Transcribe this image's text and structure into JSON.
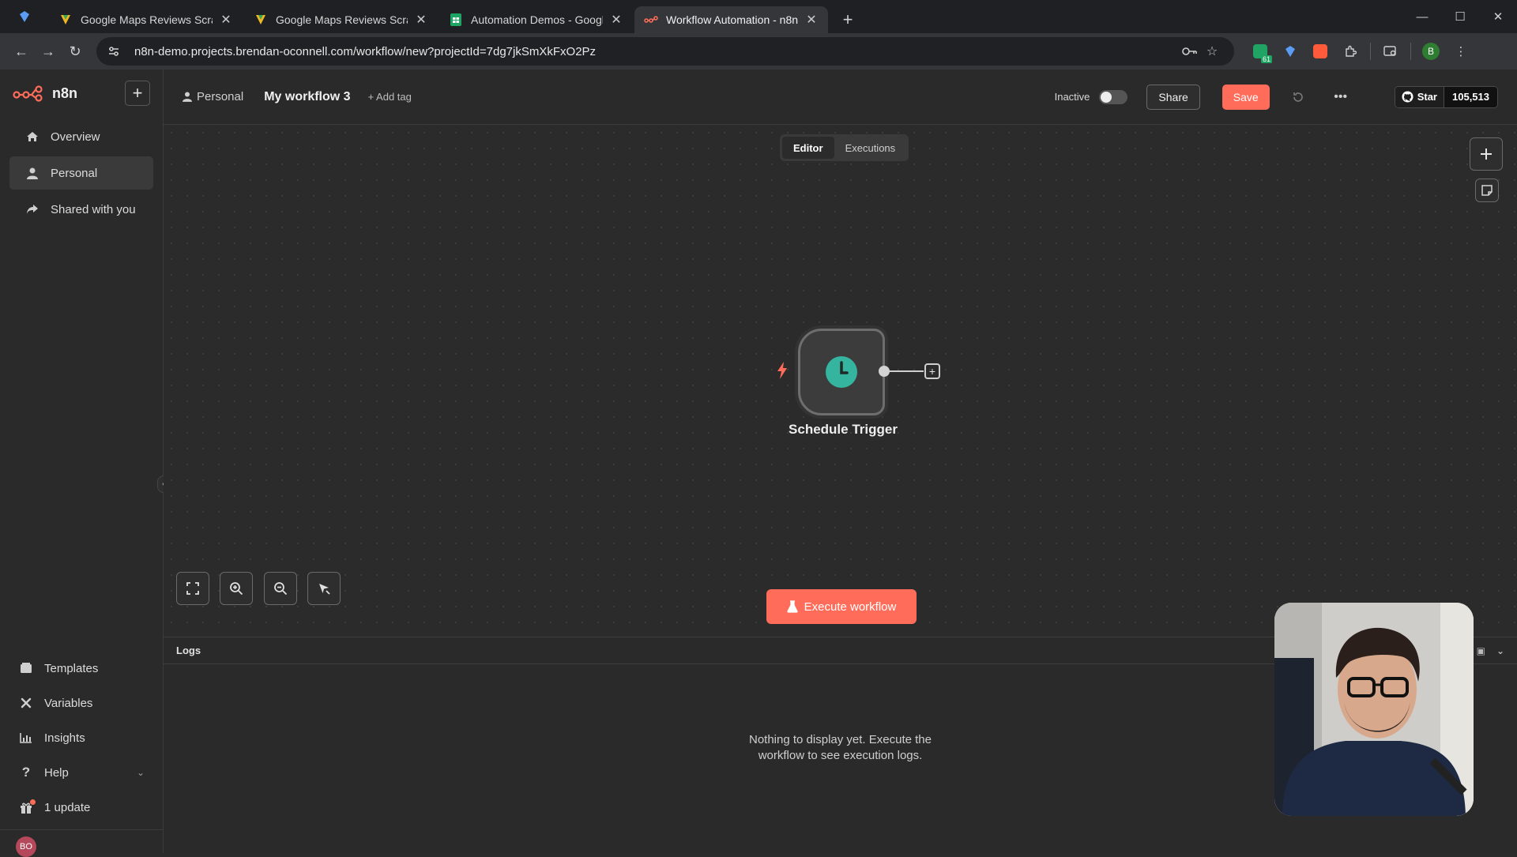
{
  "browser": {
    "tabs": [
      {
        "title": "Google Maps Reviews Scraper",
        "active": false
      },
      {
        "title": "Google Maps Reviews Scraper",
        "active": false
      },
      {
        "title": "Automation Demos - Google Sl",
        "active": false
      },
      {
        "title": "Workflow Automation - n8n",
        "active": true
      }
    ],
    "url": "n8n-demo.projects.brendan-oconnell.com/workflow/new?projectId=7dg7jkSmXkFxO2Pz",
    "profile_initial": "B",
    "ext_badge": "61"
  },
  "sidebar": {
    "logo": "n8n",
    "items": [
      {
        "label": "Overview",
        "icon": "home-icon"
      },
      {
        "label": "Personal",
        "icon": "user-icon",
        "active": true
      },
      {
        "label": "Shared with you",
        "icon": "share-icon"
      }
    ],
    "bottom_items": [
      {
        "label": "Templates",
        "icon": "templates-icon"
      },
      {
        "label": "Variables",
        "icon": "variables-icon"
      },
      {
        "label": "Insights",
        "icon": "insights-icon"
      },
      {
        "label": "Help",
        "icon": "help-icon"
      },
      {
        "label": "1 update",
        "icon": "gift-icon"
      }
    ],
    "user_initials": "BO"
  },
  "header": {
    "project": "Personal",
    "workflow_name": "My workflow 3",
    "add_tag": "+ Add tag",
    "status_label": "Inactive",
    "share_label": "Share",
    "save_label": "Save",
    "star_label": "Star",
    "star_count": "105,513"
  },
  "canvas": {
    "tabs": [
      {
        "label": "Editor",
        "active": true
      },
      {
        "label": "Executions",
        "active": false
      }
    ],
    "node": {
      "title": "Schedule Trigger",
      "icon": "clock-icon"
    },
    "execute_label": "Execute workflow"
  },
  "logs": {
    "title": "Logs",
    "empty_line1": "Nothing to display yet. Execute the",
    "empty_line2": "workflow to see execution logs."
  },
  "colors": {
    "accent": "#ff6d5a",
    "node_icon": "#35b5a0",
    "background": "#2b2b2b"
  }
}
